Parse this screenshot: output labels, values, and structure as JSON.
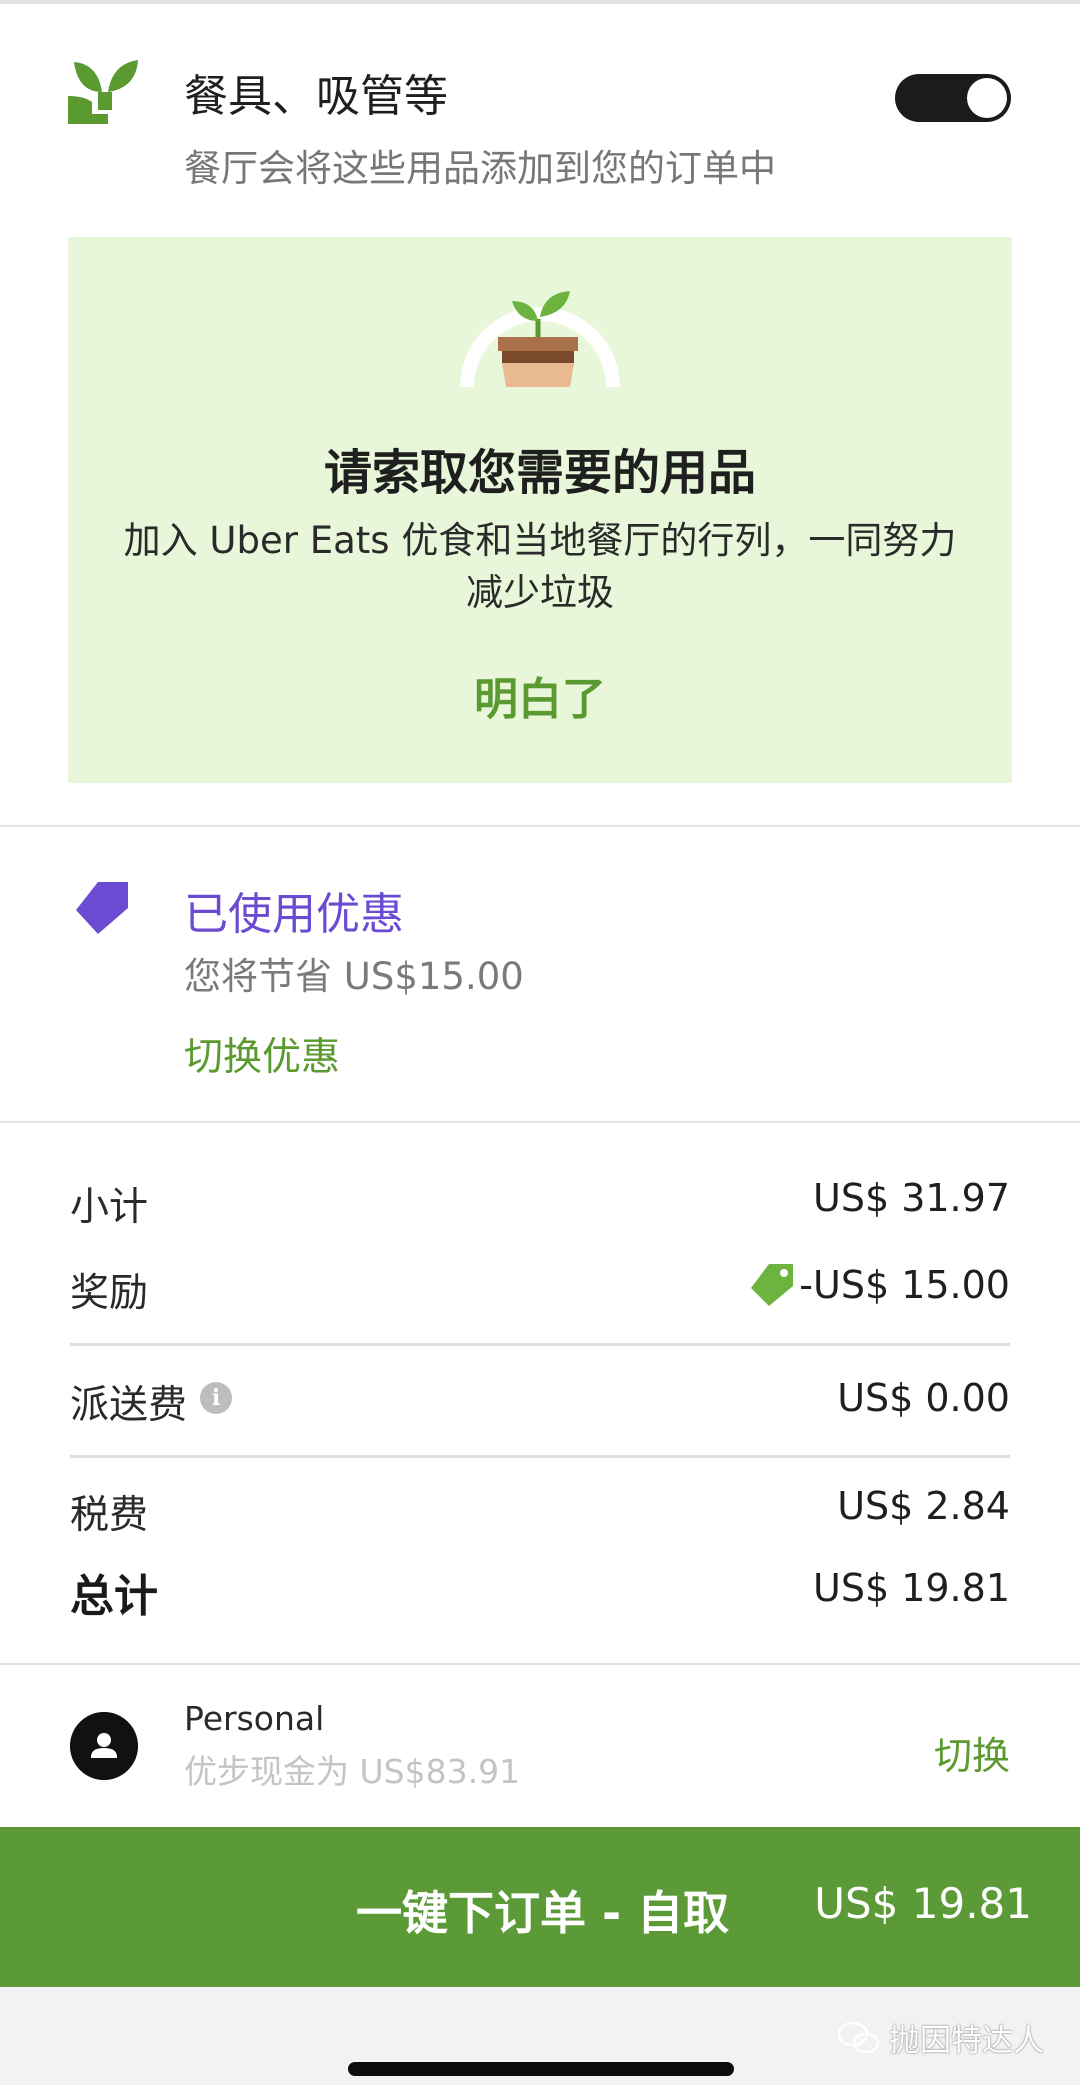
{
  "utensils": {
    "title": "餐具、吸管等",
    "subtitle": "餐厅会将这些用品添加到您的订单中",
    "toggle_on": true,
    "icon": "sprout-icon"
  },
  "eco_card": {
    "title": "请索取您需要的用品",
    "body": "加入 Uber Eats 优食和当地餐厅的行列，一同努力减少垃圾",
    "cta": "明白了",
    "illustration": "potted-plant-icon"
  },
  "promotion": {
    "icon": "tag-icon",
    "title": "已使用优惠",
    "saving": "您将节省 US$15.00",
    "switch_label": "切换优惠"
  },
  "summary": {
    "subtotal_label": "小计",
    "subtotal_value": "US$ 31.97",
    "reward_label": "奖励",
    "reward_value": "-US$ 15.00",
    "delivery_label": "派送费",
    "delivery_value": "US$ 0.00",
    "tax_label": "税费",
    "tax_value": "US$ 2.84",
    "total_label": "总计",
    "total_value": "US$ 19.81"
  },
  "payment": {
    "name": "Personal",
    "balance": "优步现金为 US$83.91",
    "switch_label": "切换"
  },
  "order_button": {
    "label": "一键下订单 - 自取",
    "price": "US$ 19.81"
  },
  "watermark": "抛因特达人",
  "colors": {
    "accent_green": "#5b9a36",
    "promo_purple": "#6b4bd1",
    "card_green_bg": "#e8f7d9"
  }
}
